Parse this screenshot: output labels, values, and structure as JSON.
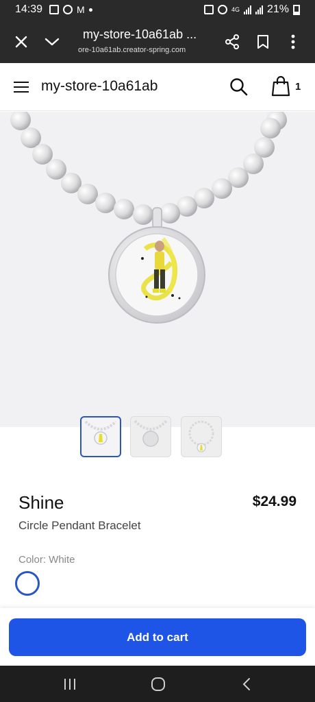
{
  "status_bar": {
    "time": "14:39",
    "network": "4G",
    "battery": "21%"
  },
  "browser": {
    "page_title": "my-store-10a61ab ...",
    "url": "ore-10a61ab.creator-spring.com"
  },
  "store_header": {
    "store_name": "my-store-10a61ab",
    "cart_count": "1"
  },
  "product": {
    "title": "Shine",
    "price": "$24.99",
    "subtitle": "Circle Pendant Bracelet",
    "color_label": "Color: White",
    "selected_color": "#ffffff"
  },
  "gallery": {
    "selected_index": 0,
    "thumbnail_count": 3
  },
  "cta": {
    "add_to_cart": "Add to cart"
  },
  "colors": {
    "accent": "#1f55e6",
    "selection_ring": "#2a55c4",
    "pendant_art": "#e6df2a"
  }
}
